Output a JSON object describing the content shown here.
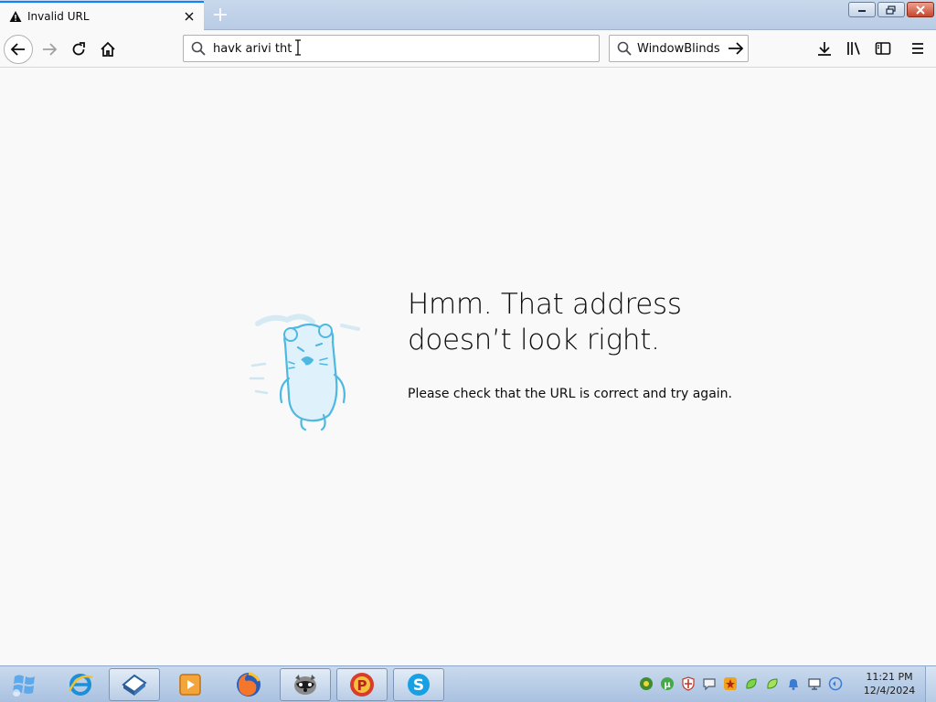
{
  "tab": {
    "title": "Invalid URL"
  },
  "urlbar": {
    "value": "havk arivi tht"
  },
  "searchbar": {
    "engine": "WindowBlinds"
  },
  "error": {
    "title_line1": "Hmm. That address",
    "title_line2": "doesn’t look right.",
    "description": "Please check that the URL is correct and try again."
  },
  "clock": {
    "time": "11:21 PM",
    "date": "12/4/2024"
  },
  "colors": {
    "accent": "#0a84ff",
    "page_bg": "#f9f9fa",
    "mascot": "#4fb8e0"
  },
  "taskbar": {
    "apps": [
      "internet-explorer-icon",
      "windowblinds-icon",
      "media-player-icon",
      "firefox-icon",
      "raccoon-app-icon",
      "p-app-icon",
      "skype-icon"
    ],
    "tray": [
      "green-globe-icon",
      "utorrent-icon",
      "shield-icon",
      "chat-icon",
      "star-icon",
      "green-leaf-icon",
      "green-leaf-icon",
      "bell-icon",
      "network-icon",
      "volume-icon"
    ]
  }
}
